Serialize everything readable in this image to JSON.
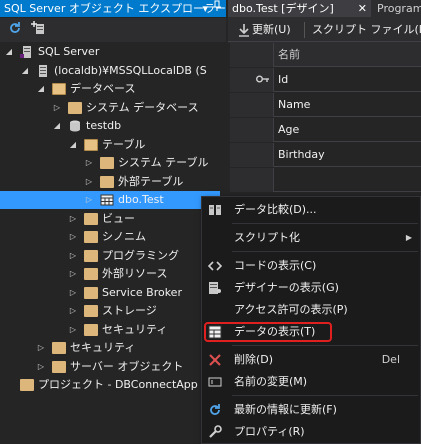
{
  "explorer": {
    "title": "SQL Server オブジェクト エクスプローラー",
    "dropdown_glyph": "▾",
    "pin_glyph": "⊿",
    "toolbar": {
      "refresh_icon": "refresh-icon",
      "add_server_icon": "add-server-icon"
    },
    "tree": [
      {
        "label": "SQL Server",
        "level": 0,
        "state": "expanded",
        "icon": "server-icon"
      },
      {
        "label": "(localdb)¥MSSQLLocalDB (S",
        "level": 1,
        "state": "expanded",
        "icon": "instance-icon"
      },
      {
        "label": "データベース",
        "level": 2,
        "state": "expanded",
        "icon": "folder-icon"
      },
      {
        "label": "システム データベース",
        "level": 3,
        "state": "collapsed",
        "icon": "folder-icon"
      },
      {
        "label": "testdb",
        "level": 3,
        "state": "expanded",
        "icon": "database-icon"
      },
      {
        "label": "テーブル",
        "level": 4,
        "state": "expanded",
        "icon": "folder-icon"
      },
      {
        "label": "システム テーブル",
        "level": 5,
        "state": "collapsed",
        "icon": "folder-icon"
      },
      {
        "label": "外部テーブル",
        "level": 5,
        "state": "collapsed",
        "icon": "folder-icon"
      },
      {
        "label": "dbo.Test",
        "level": 5,
        "state": "collapsed",
        "icon": "table-icon",
        "selected": true
      },
      {
        "label": "ビュー",
        "level": 4,
        "state": "collapsed",
        "icon": "folder-icon"
      },
      {
        "label": "シノニム",
        "level": 4,
        "state": "collapsed",
        "icon": "folder-icon"
      },
      {
        "label": "プログラミング",
        "level": 4,
        "state": "collapsed",
        "icon": "folder-icon"
      },
      {
        "label": "外部リソース",
        "level": 4,
        "state": "collapsed",
        "icon": "folder-icon"
      },
      {
        "label": "Service Broker",
        "level": 4,
        "state": "collapsed",
        "icon": "folder-icon"
      },
      {
        "label": "ストレージ",
        "level": 4,
        "state": "collapsed",
        "icon": "folder-icon"
      },
      {
        "label": "セキュリティ",
        "level": 4,
        "state": "collapsed",
        "icon": "folder-icon"
      },
      {
        "label": "セキュリティ",
        "level": 2,
        "state": "collapsed",
        "icon": "folder-icon"
      },
      {
        "label": "サーバー オブジェクト",
        "level": 2,
        "state": "collapsed",
        "icon": "folder-icon"
      },
      {
        "label": "プロジェクト - DBConnectApp",
        "level": 0,
        "state": "none",
        "icon": "folder-icon"
      }
    ]
  },
  "designer": {
    "tabs": [
      {
        "label": "dbo.Test [デザイン]",
        "active": true,
        "close_glyph": "✕"
      },
      {
        "label": "Program",
        "active": false
      }
    ],
    "toolbar": {
      "update_label": "更新(U)",
      "script_label": "スクリプト ファイル(I):"
    },
    "grid": {
      "column_header": "名前",
      "rows": [
        {
          "name": "Id",
          "key": true
        },
        {
          "name": "Name",
          "key": false
        },
        {
          "name": "Age",
          "key": false
        },
        {
          "name": "Birthday",
          "key": false
        },
        {
          "name": "",
          "key": false
        }
      ]
    }
  },
  "context_menu": {
    "items": [
      {
        "label": "データ比較(D)...",
        "icon": "data-compare-icon",
        "shortcut": "",
        "submenu": false
      },
      {
        "label": "スクリプト化",
        "icon": "",
        "shortcut": "",
        "submenu": true
      },
      {
        "label": "コードの表示(C)",
        "icon": "code-icon",
        "shortcut": "",
        "submenu": false
      },
      {
        "label": "デザイナーの表示(G)",
        "icon": "designer-icon",
        "shortcut": "",
        "submenu": false
      },
      {
        "label": "アクセス許可の表示(P)",
        "icon": "",
        "shortcut": "",
        "submenu": false
      },
      {
        "label": "データの表示(T)",
        "icon": "view-data-icon",
        "shortcut": "",
        "submenu": false,
        "highlighted": true
      },
      {
        "label": "削除(D)",
        "icon": "delete-icon",
        "shortcut": "Del",
        "submenu": false
      },
      {
        "label": "名前の変更(M)",
        "icon": "rename-icon",
        "shortcut": "",
        "submenu": false
      },
      {
        "label": "最新の情報に更新(F)",
        "icon": "refresh-icon",
        "shortcut": "",
        "submenu": false
      },
      {
        "label": "プロパティ(R)",
        "icon": "wrench-icon",
        "shortcut": "",
        "submenu": false
      }
    ]
  },
  "colors": {
    "accent": "#007acc",
    "selection": "#3399ff",
    "highlight_ring": "#e02020",
    "background": "#252526"
  }
}
